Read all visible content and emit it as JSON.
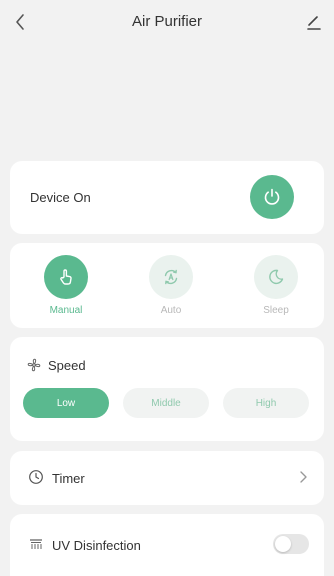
{
  "header": {
    "title": "Air Purifier",
    "back_icon": "chevron-left-icon",
    "edit_icon": "edit-icon"
  },
  "power": {
    "label": "Device On",
    "icon": "power-icon",
    "on": true
  },
  "modes": [
    {
      "label": "Manual",
      "icon": "hand-icon",
      "active": true
    },
    {
      "label": "Auto",
      "icon": "auto-icon",
      "active": false
    },
    {
      "label": "Sleep",
      "icon": "moon-icon",
      "active": false
    }
  ],
  "speed": {
    "title": "Speed",
    "icon": "fan-icon",
    "options": [
      "Low",
      "Middle",
      "High"
    ],
    "selected": "Low"
  },
  "timer": {
    "label": "Timer",
    "icon": "clock-icon"
  },
  "uv": {
    "label": "UV Disinfection",
    "icon": "uv-lamp-icon",
    "enabled": false
  },
  "colors": {
    "accent": "#5ab98f",
    "accent_light": "#eaf2ee",
    "background": "#f2f2f2",
    "card": "#ffffff"
  }
}
